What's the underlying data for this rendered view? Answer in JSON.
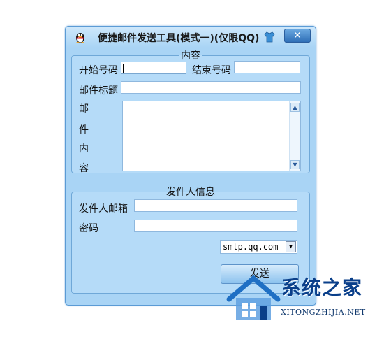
{
  "window": {
    "title": "便捷邮件发送工具(模式一)(仅限QQ)",
    "close_label": "✕"
  },
  "content_group": {
    "legend": "内容",
    "start_label": "开始号码",
    "start_value": "",
    "end_label": "结束号码",
    "end_value": "",
    "subject_label": "邮件标题",
    "subject_value": "",
    "body_label_chars": [
      "邮",
      "件",
      "内",
      "容"
    ],
    "body_value": ""
  },
  "sender_group": {
    "legend": "发件人信息",
    "email_label": "发件人邮箱",
    "email_value": "",
    "password_label": "密码",
    "password_value": "",
    "smtp_selected": "smtp.qq.com"
  },
  "actions": {
    "send_label": "发送"
  },
  "watermark": {
    "title": "系统之家",
    "subtitle": "XITONGZHIJIA.NET"
  },
  "colors": {
    "window_bg": "#a9d4f5",
    "group_bg": "#b5dbf8",
    "border": "#5b9bd5",
    "close_button": "#2f6fb7",
    "watermark_text": "#0a3f8a"
  },
  "icons": {
    "app": "qq-penguin-icon",
    "skin": "shirt-icon",
    "close": "close-icon",
    "scroll_up": "scroll-up-arrow-icon",
    "scroll_down": "scroll-down-arrow-icon",
    "dropdown": "chevron-down-icon"
  }
}
